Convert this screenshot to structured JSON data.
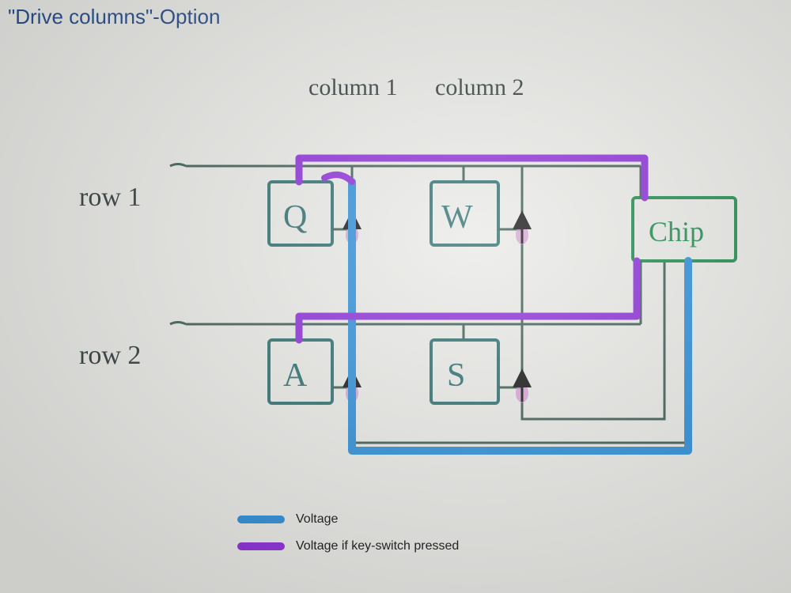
{
  "title": "\"Drive columns\"-Option",
  "columns": {
    "c1": "column 1",
    "c2": "column 2"
  },
  "rows": {
    "r1": "row 1",
    "r2": "row 2"
  },
  "keys": {
    "q": "Q",
    "w": "W",
    "a": "A",
    "s": "S"
  },
  "chip_label": "Chip",
  "legend": {
    "voltage": "Voltage",
    "voltage_pressed": "Voltage if key-switch pressed"
  },
  "colors": {
    "title": "#244b8a",
    "ink": "#2f3a3a",
    "key_outline": "#2b6d6d",
    "chip": "#1a8a4a",
    "voltage": "#2a8cd8",
    "voltage_pressed": "#8a2bd8",
    "diode_mark": "#d088d0"
  },
  "diagram": {
    "type": "keyboard-matrix",
    "drive": "columns",
    "read": "rows",
    "matrix": [
      {
        "row": 1,
        "col": 1,
        "key": "Q"
      },
      {
        "row": 1,
        "col": 2,
        "key": "W"
      },
      {
        "row": 2,
        "col": 1,
        "key": "A"
      },
      {
        "row": 2,
        "col": 2,
        "key": "S"
      }
    ],
    "diode_direction": "column-to-row (arrow from column line up toward row line)",
    "example_scan": {
      "driven_column": 1,
      "pressed_keys": [
        "Q",
        "A"
      ]
    }
  }
}
